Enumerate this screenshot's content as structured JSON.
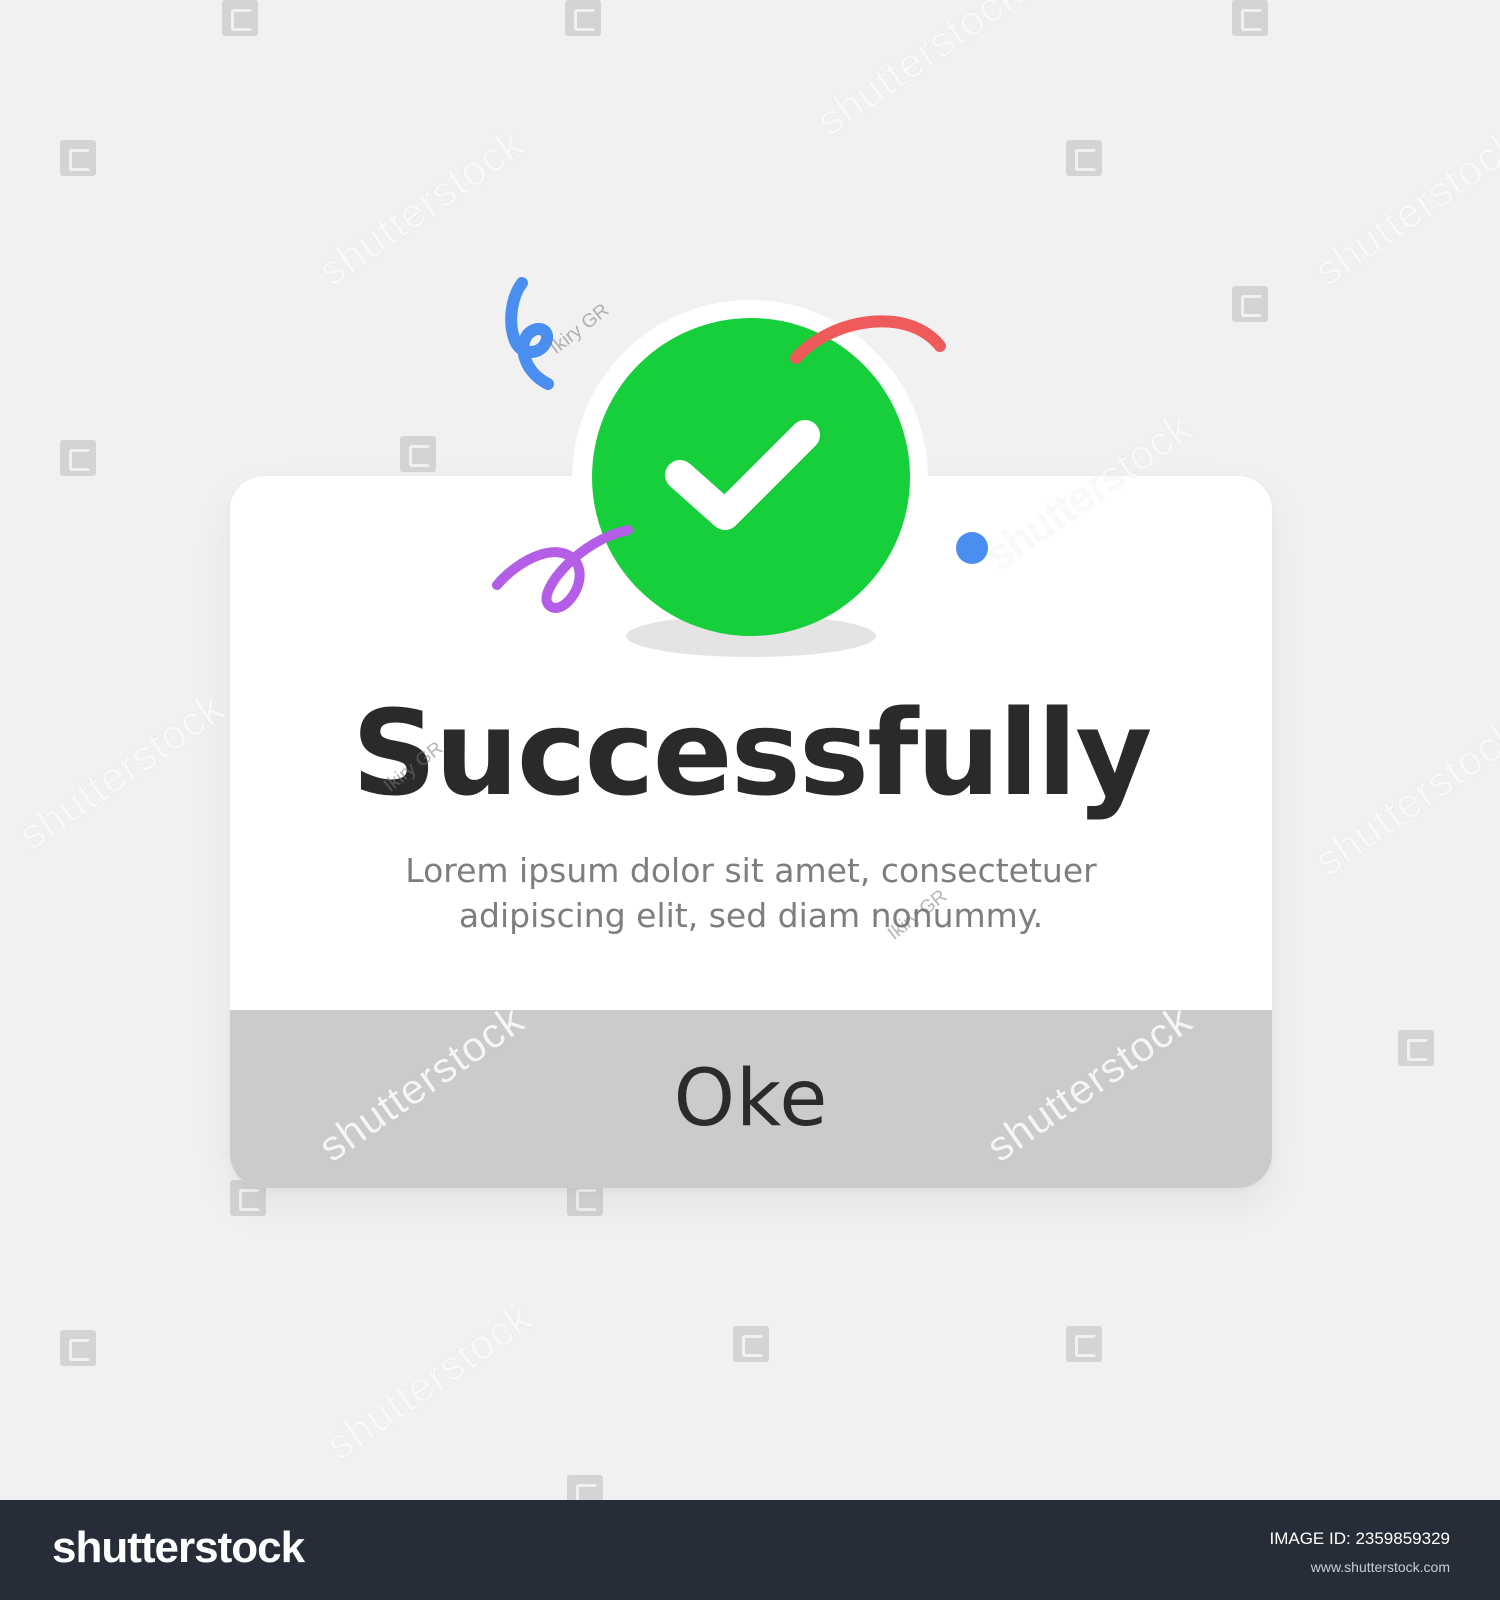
{
  "dialog": {
    "title": "Successfully",
    "message_line1": "Lorem ipsum dolor sit amet, consectetuer",
    "message_line2": "adipiscing elit, sed diam nonummy.",
    "ok_label": "Oke",
    "badge_icon": "check-icon",
    "badge_color": "#16cf3a",
    "footer_color": "#cbcbcb"
  },
  "decorations": {
    "colors": {
      "blue": "#4a8ff0",
      "red": "#ef5a5a",
      "purple": "#b45ee8"
    }
  },
  "watermark": {
    "brand": "shutterstock",
    "author": "Ikiry GR"
  },
  "stock_bar": {
    "logo": "shutterstock",
    "image_id": "IMAGE ID: 2359859329",
    "url": "www.shutterstock.com"
  }
}
